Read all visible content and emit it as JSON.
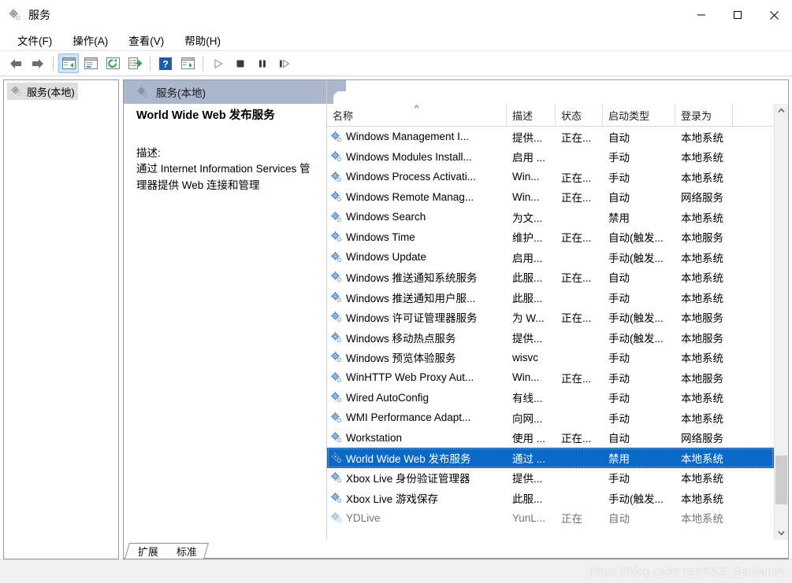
{
  "window": {
    "title": "服务",
    "icon": "services-gear-icon",
    "minimize_label": "—",
    "maximize_label": "□",
    "close_label": "✕"
  },
  "menubar": {
    "items": [
      {
        "label": "文件(F)",
        "name": "menu-file"
      },
      {
        "label": "操作(A)",
        "name": "menu-action"
      },
      {
        "label": "查看(V)",
        "name": "menu-view"
      },
      {
        "label": "帮助(H)",
        "name": "menu-help"
      }
    ]
  },
  "toolbar": {
    "buttons": [
      {
        "name": "back-icon",
        "glyph": "←"
      },
      {
        "name": "forward-icon",
        "glyph": "→"
      },
      {
        "name": "show-tree-icon",
        "glyph": "▤"
      },
      {
        "name": "properties-icon",
        "glyph": "▣"
      },
      {
        "name": "refresh-icon",
        "glyph": "⟳"
      },
      {
        "name": "export-list-icon",
        "glyph": "⇥"
      },
      {
        "name": "help-icon",
        "glyph": "?"
      },
      {
        "name": "show-console-icon",
        "glyph": "▶"
      },
      {
        "name": "start-service-icon",
        "glyph": "▶"
      },
      {
        "name": "stop-service-icon",
        "glyph": "■"
      },
      {
        "name": "pause-service-icon",
        "glyph": "❚❚"
      },
      {
        "name": "restart-service-icon",
        "glyph": "❚▶"
      }
    ]
  },
  "tree": {
    "items": [
      {
        "label": "服务(本地)",
        "icon": "services-gear-icon",
        "selected": true
      }
    ]
  },
  "pane_header": {
    "title": "服务(本地)",
    "icon": "services-gear-icon"
  },
  "detail": {
    "title": "World Wide Web 发布服务",
    "description_label": "描述:",
    "description_text": "通过 Internet Information Services 管理器提供 Web 连接和管理"
  },
  "list": {
    "columns": [
      {
        "label": "名称",
        "name": "column-name",
        "sorted": true,
        "sort_caret": "^"
      },
      {
        "label": "描述",
        "name": "column-description"
      },
      {
        "label": "状态",
        "name": "column-status"
      },
      {
        "label": "启动类型",
        "name": "column-startup-type"
      },
      {
        "label": "登录为",
        "name": "column-log-on-as"
      }
    ],
    "rows": [
      {
        "name": "Windows Management I...",
        "description": "提供...",
        "status": "正在...",
        "startup": "自动",
        "logon": "本地系统",
        "selected": false
      },
      {
        "name": "Windows Modules Install...",
        "description": "启用 ...",
        "status": "",
        "startup": "手动",
        "logon": "本地系统",
        "selected": false
      },
      {
        "name": "Windows Process Activati...",
        "description": "Win...",
        "status": "正在...",
        "startup": "手动",
        "logon": "本地系统",
        "selected": false
      },
      {
        "name": "Windows Remote Manag...",
        "description": "Win...",
        "status": "正在...",
        "startup": "自动",
        "logon": "网络服务",
        "selected": false
      },
      {
        "name": "Windows Search",
        "description": "为文...",
        "status": "",
        "startup": "禁用",
        "logon": "本地系统",
        "selected": false
      },
      {
        "name": "Windows Time",
        "description": "维护...",
        "status": "正在...",
        "startup": "自动(触发...",
        "logon": "本地服务",
        "selected": false
      },
      {
        "name": "Windows Update",
        "description": "启用...",
        "status": "",
        "startup": "手动(触发...",
        "logon": "本地系统",
        "selected": false
      },
      {
        "name": "Windows 推送通知系统服务",
        "description": "此服...",
        "status": "正在...",
        "startup": "自动",
        "logon": "本地系统",
        "selected": false
      },
      {
        "name": "Windows 推送通知用户服...",
        "description": "此服...",
        "status": "",
        "startup": "手动",
        "logon": "本地系统",
        "selected": false
      },
      {
        "name": "Windows 许可证管理器服务",
        "description": "为 W...",
        "status": "正在...",
        "startup": "手动(触发...",
        "logon": "本地服务",
        "selected": false
      },
      {
        "name": "Windows 移动热点服务",
        "description": "提供...",
        "status": "",
        "startup": "手动(触发...",
        "logon": "本地服务",
        "selected": false
      },
      {
        "name": "Windows 预览体验服务",
        "description": "wisvc",
        "status": "",
        "startup": "手动",
        "logon": "本地系统",
        "selected": false
      },
      {
        "name": "WinHTTP Web Proxy Aut...",
        "description": "Win...",
        "status": "正在...",
        "startup": "手动",
        "logon": "本地服务",
        "selected": false
      },
      {
        "name": "Wired AutoConfig",
        "description": "有线...",
        "status": "",
        "startup": "手动",
        "logon": "本地系统",
        "selected": false
      },
      {
        "name": "WMI Performance Adapt...",
        "description": "向网...",
        "status": "",
        "startup": "手动",
        "logon": "本地系统",
        "selected": false
      },
      {
        "name": "Workstation",
        "description": "使用 ...",
        "status": "正在...",
        "startup": "自动",
        "logon": "网络服务",
        "selected": false
      },
      {
        "name": "World Wide Web 发布服务",
        "description": "通过 ...",
        "status": "",
        "startup": "禁用",
        "logon": "本地系统",
        "selected": true
      },
      {
        "name": "Xbox Live 身份验证管理器",
        "description": "提供...",
        "status": "",
        "startup": "手动",
        "logon": "本地系统",
        "selected": false
      },
      {
        "name": "Xbox Live 游戏保存",
        "description": "此服...",
        "status": "",
        "startup": "手动(触发...",
        "logon": "本地系统",
        "selected": false
      },
      {
        "name": "YDLive",
        "description": "YunL...",
        "status": "正在",
        "startup": "自动",
        "logon": "本地系统",
        "selected": false,
        "partial": true
      }
    ]
  },
  "tabs": [
    {
      "label": "扩展",
      "name": "tab-extended",
      "active": false
    },
    {
      "label": "标准",
      "name": "tab-standard",
      "active": true
    }
  ],
  "statusbar": {
    "watermark": "https://blog.csdn.net/SSS_Benjamin"
  },
  "colors": {
    "selection": "#0a68c8",
    "pane_header_band": "#aab7cd",
    "toolbar_active": "#cde6f7"
  }
}
